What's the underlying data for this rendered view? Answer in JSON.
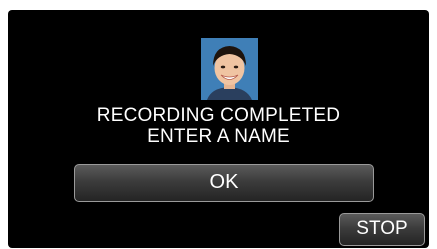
{
  "dialog": {
    "thumbnail_icon": "face-photo",
    "message_line1": "RECORDING COMPLETED",
    "message_line2": "ENTER A NAME"
  },
  "buttons": {
    "ok_label": "OK",
    "stop_label": "STOP"
  },
  "colors": {
    "background": "#000000",
    "button_border": "#9a9a9a",
    "text": "#ffffff"
  }
}
